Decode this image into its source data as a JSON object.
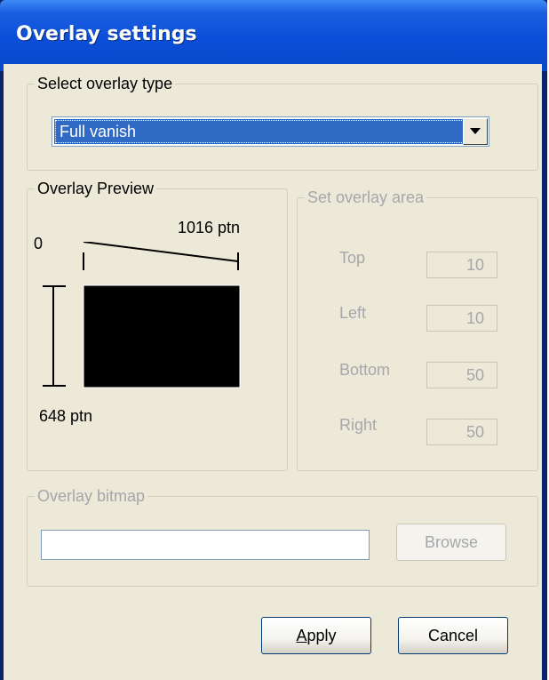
{
  "window": {
    "title": "Overlay settings"
  },
  "overlay_type": {
    "legend": "Select overlay type",
    "selected": "Full vanish",
    "dropdown_icon": "chevron-down-icon"
  },
  "preview": {
    "legend": "Overlay Preview",
    "origin_label": "0",
    "width_label": "1016 ptn",
    "height_label": "648 ptn"
  },
  "area": {
    "legend": "Set overlay area",
    "top_label": "Top",
    "top_value": "10",
    "left_label": "Left",
    "left_value": "10",
    "bottom_label": "Bottom",
    "bottom_value": "50",
    "right_label": "Right",
    "right_value": "50"
  },
  "bitmap": {
    "legend": "Overlay bitmap",
    "path_value": "",
    "browse_label": "Browse"
  },
  "buttons": {
    "apply_access": "A",
    "apply_rest": "pply",
    "cancel": "Cancel"
  },
  "colors": {
    "titlebar": "#0a58e0",
    "selection": "#316ac5",
    "dialog_face": "#ece9d8",
    "disabled_text": "#a7a6aa"
  }
}
